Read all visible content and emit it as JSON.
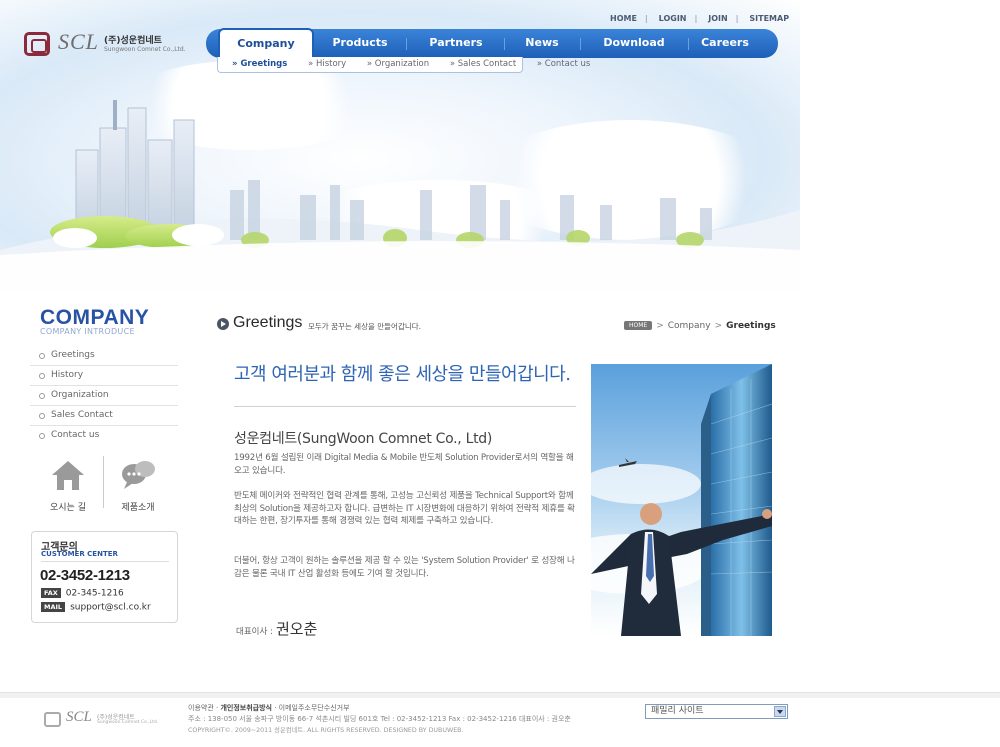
{
  "brand": {
    "name": "SCL",
    "korean_name": "(주)성운컴네트",
    "english_name": "Sungwoon Comnet Co.,Ltd."
  },
  "util_nav": [
    "HOME",
    "LOGIN",
    "JOIN",
    "SITEMAP"
  ],
  "main_nav": {
    "active": "Company",
    "tabs": [
      "Company",
      "Products",
      "Partners",
      "News",
      "Download",
      "Careers"
    ]
  },
  "sub_nav": [
    "Greetings",
    "History",
    "Organization",
    "Sales Contact",
    "Contact us"
  ],
  "sidebar": {
    "title": "COMPANY",
    "subtitle": "COMPANY INTRODUCE",
    "items": [
      "Greetings",
      "History",
      "Organization",
      "Sales Contact",
      "Contact us"
    ],
    "quick_links": [
      {
        "label": "오시는 길",
        "icon": "home-icon"
      },
      {
        "label": "제품소개",
        "icon": "chat-bubbles-icon"
      }
    ],
    "customer_center": {
      "title_kr": "고객문의",
      "title_en": "CUSTOMER CENTER",
      "phone": "02-3452-1213",
      "fax_tag": "FAX",
      "fax": "02-345-1216",
      "mail_tag": "MAIL",
      "email": "support@scl.co.kr"
    }
  },
  "content": {
    "title": "Greetings",
    "subtitle": "모두가 꿈꾸는 세상을 만들어갑니다.",
    "breadcrumb": {
      "home": "HOME",
      "section": "Company",
      "current": "Greetings"
    },
    "headline": "고객 여러분과 함께 좋은 세상을 만들어갑니다.",
    "company_name": "성운컴네트(SungWoon Comnet Co., Ltd)",
    "paragraphs": [
      "1992년 6월 설립된 이래 Digital Media & Mobile 반도체 Solution Provider로서의 역할을 해오고 있습니다.",
      "반도체 메이커와 전략적인 협력 관계를 통해, 고성능 고신뢰성 제품을 Technical Support와 함께 최상의 Solution을 제공하고자 합니다. 급변하는 IT 시장변화에 대응하기 위하여 전략적 제휴를 확대하는 한편, 장기투자를 통해 경쟁력 있는 협력 체제를 구축하고 있습니다.",
      "더불어, 항상 고객이 원하는 솔루션을 제공 할 수 있는 'System Solution Provider' 로 성장해 나감은 물론 국내 IT 산업 활성화 등에도 기여 할 것입니다."
    ],
    "ceo_label": "대표이사 :",
    "ceo_name": "권오춘"
  },
  "footer": {
    "links": [
      "이용약관",
      "개인정보취급방식",
      "이메일주소무단수신거부"
    ],
    "address": "주소 : 138-050 서울 송파구 방이동 66-7 석촌시티 빌딩 601호    Tel : 02-3452-1213   Fax : 02-3452-1216   대표이사 : 권오춘",
    "copyright": "COPYRIGHT©. 2009~2011 성운컴네트. ALL RIGHTS RESERVED. DESIGNED BY DUBUWEB.",
    "family_site": "패밀리 사이트"
  }
}
